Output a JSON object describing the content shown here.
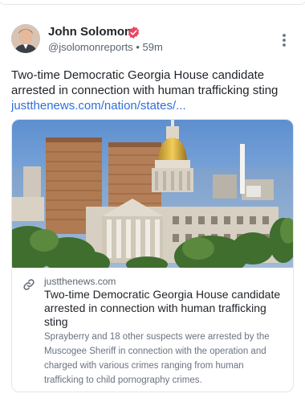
{
  "post": {
    "author_name": "John Solomon",
    "handle": "@jsolomonreports",
    "separator": "•",
    "time_ago": "59m",
    "text": "Two-time Democratic Georgia House candidate arrested in connection with human trafficking sting",
    "link_text": "justthenews.com/nation/states/..."
  },
  "link_card": {
    "domain": "justthenews.com",
    "title": "Two-time Democratic Georgia House candidate arrested in connection with human trafficking sting",
    "description": "Sprayberry and 18 other suspects were arrested by the Muscogee Sheriff in connection with the operation and charged with various crimes ranging from human trafficking to child pornography crimes."
  },
  "icons": {
    "verified": "verified-badge-icon",
    "more": "more-vertical-icon",
    "link": "link-icon"
  },
  "colors": {
    "link": "#2f6fdc",
    "verified": "#e8475f",
    "muted_text": "#5b6470"
  }
}
